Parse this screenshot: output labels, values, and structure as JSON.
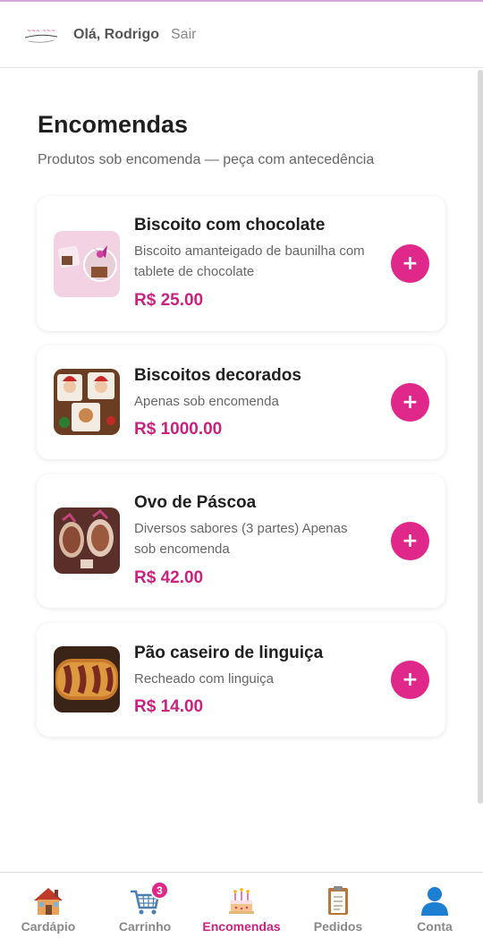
{
  "header": {
    "greeting": "Olá, Rodrigo",
    "logout_label": "Sair",
    "logo_icon": "bakery-logo"
  },
  "page": {
    "title": "Encomendas",
    "subtitle": "Produtos sob encomenda — peça com antecedência"
  },
  "products": [
    {
      "name": "Biscoito com chocolate",
      "description": "Biscoito amanteigado de baunilha com tablete de chocolate",
      "price": "R$ 25.00",
      "add_label": "+"
    },
    {
      "name": "Biscoitos decorados",
      "description": "Apenas sob encomenda",
      "price": "R$ 1000.00",
      "add_label": "+"
    },
    {
      "name": "Ovo de Páscoa",
      "description": "Diversos sabores (3 partes) Apenas sob encomenda",
      "price": "R$ 42.00",
      "add_label": "+"
    },
    {
      "name": "Pão caseiro de linguiça",
      "description": "Recheado com linguiça",
      "price": "R$ 14.00",
      "add_label": "+"
    }
  ],
  "nav": {
    "items": [
      {
        "label": "Cardápio",
        "icon": "house-icon"
      },
      {
        "label": "Carrinho",
        "icon": "cart-icon",
        "badge": "3"
      },
      {
        "label": "Encomendas",
        "icon": "cake-icon"
      },
      {
        "label": "Pedidos",
        "icon": "clipboard-icon"
      },
      {
        "label": "Conta",
        "icon": "user-icon"
      }
    ],
    "active": "Encomendas"
  },
  "colors": {
    "accent": "#e0288a",
    "price": "#c8237f",
    "active_nav": "#c8237f"
  }
}
